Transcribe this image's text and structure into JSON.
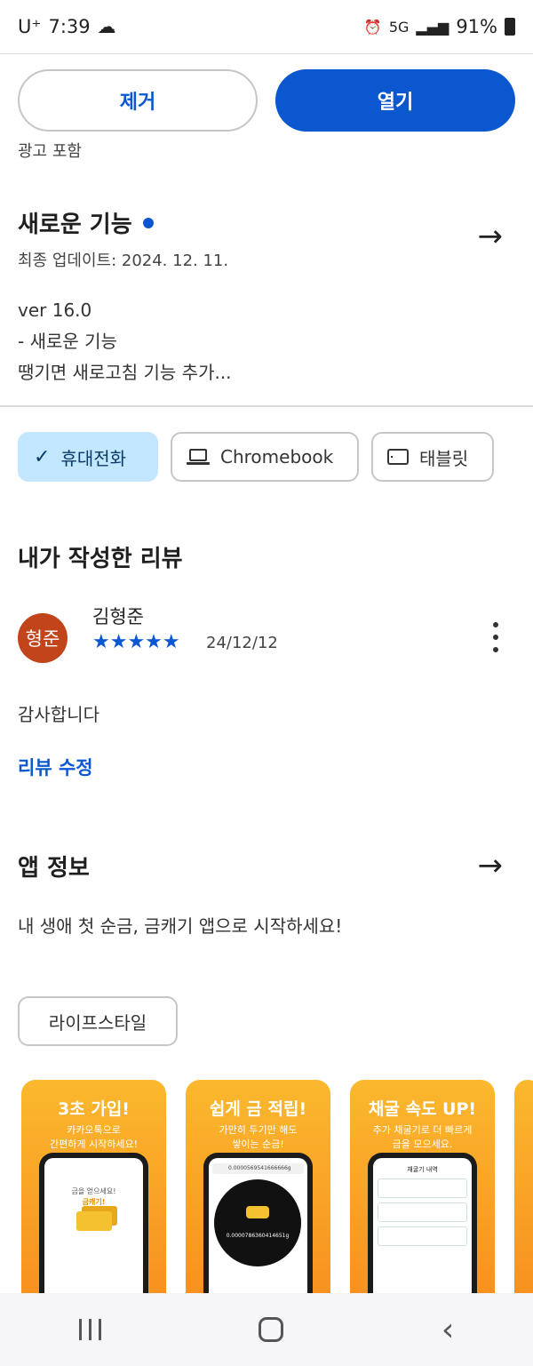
{
  "status_bar": {
    "carrier": "U⁺",
    "time": "7:39",
    "network": "5G",
    "battery": "91%"
  },
  "actions": {
    "remove_label": "제거",
    "open_label": "열기",
    "ads_note": "광고 포함"
  },
  "whats_new": {
    "title": "새로운 기능",
    "last_updated": "최종 업데이트: 2024. 12. 11.",
    "notes": [
      "ver 16.0",
      "- 새로운 기능",
      "땡기면 새로고침 기능 추가..."
    ]
  },
  "device_chips": [
    {
      "label": "휴대전화",
      "selected": true,
      "icon": "check-icon"
    },
    {
      "label": "Chromebook",
      "selected": false,
      "icon": "laptop-icon"
    },
    {
      "label": "태블릿",
      "selected": false,
      "icon": "tablet-icon"
    }
  ],
  "my_review": {
    "heading": "내가 작성한 리뷰",
    "avatar_text": "형준",
    "reviewer": "김형준",
    "stars": "★★★★★",
    "rating": 5,
    "date": "24/12/12",
    "text": "감사합니다",
    "edit_label": "리뷰 수정"
  },
  "app_info": {
    "heading": "앱 정보",
    "description": "내 생애 첫 순금, 금캐기 앱으로 시작하세요!",
    "category": "라이프스타일"
  },
  "screenshots": [
    {
      "title": "3초 가입!",
      "sub1": "카카오톡으로",
      "sub2": "간편하게 시작하세요!",
      "screen_line1": "금을 얻으세요!",
      "screen_line2": "금캐기!"
    },
    {
      "title": "쉽게 금 적립!",
      "sub1": "가만히 두기만 해도",
      "sub2": "쌓이는 순금!",
      "screen_bar": "0.0000569541666666g",
      "screen_num": "0.0000786360414651g"
    },
    {
      "title": "채굴 속도 UP!",
      "sub1": "추가 채굴기로 더 빠르게",
      "sub2": "금을 모으세요.",
      "screen_title": "채굴기 내역"
    }
  ],
  "colors": {
    "accent": "#0b57d0",
    "selected_chip": "#c2e7ff",
    "avatar": "#c1441a",
    "shot_top": "#fbb82e",
    "shot_bottom": "#f78e1e"
  }
}
